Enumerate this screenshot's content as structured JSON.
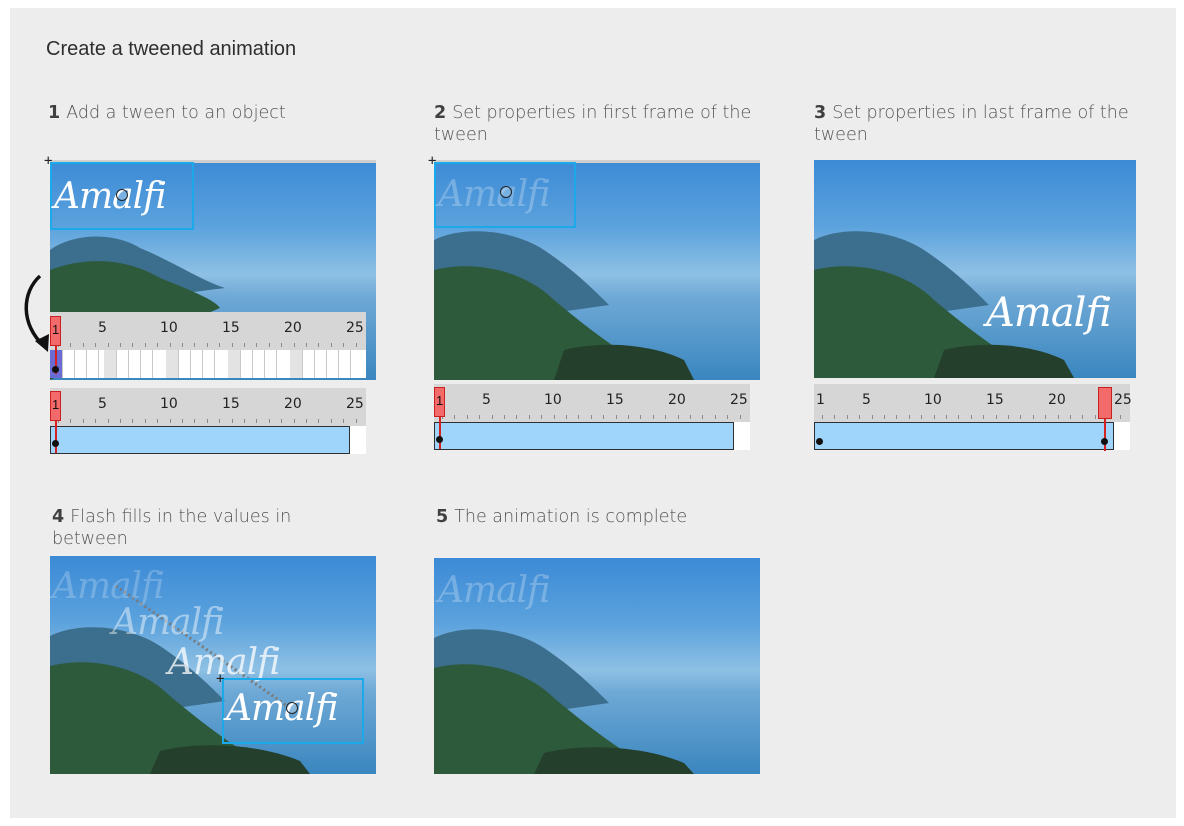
{
  "title": "Create a tweened animation",
  "steps": [
    {
      "number": "1",
      "text": "Add a tween to an object"
    },
    {
      "number": "2",
      "text": "Set properties in first frame of the tween"
    },
    {
      "number": "3",
      "text": "Set properties in last frame of the tween"
    },
    {
      "number": "4",
      "text": "Flash fills in the values in between"
    },
    {
      "number": "5",
      "text": "The animation is complete"
    }
  ],
  "object_text": "Amalfi",
  "timeline": {
    "ticks": [
      "1",
      "5",
      "10",
      "15",
      "20",
      "25"
    ]
  },
  "colors": {
    "selection": "#1ba9e9",
    "playhead": "#f36a6a",
    "tween_span": "#9fd4fb"
  },
  "icons": [
    "curved-arrow-icon",
    "crosshair-icon",
    "registration-point-icon",
    "keyframe-dot-icon"
  ]
}
